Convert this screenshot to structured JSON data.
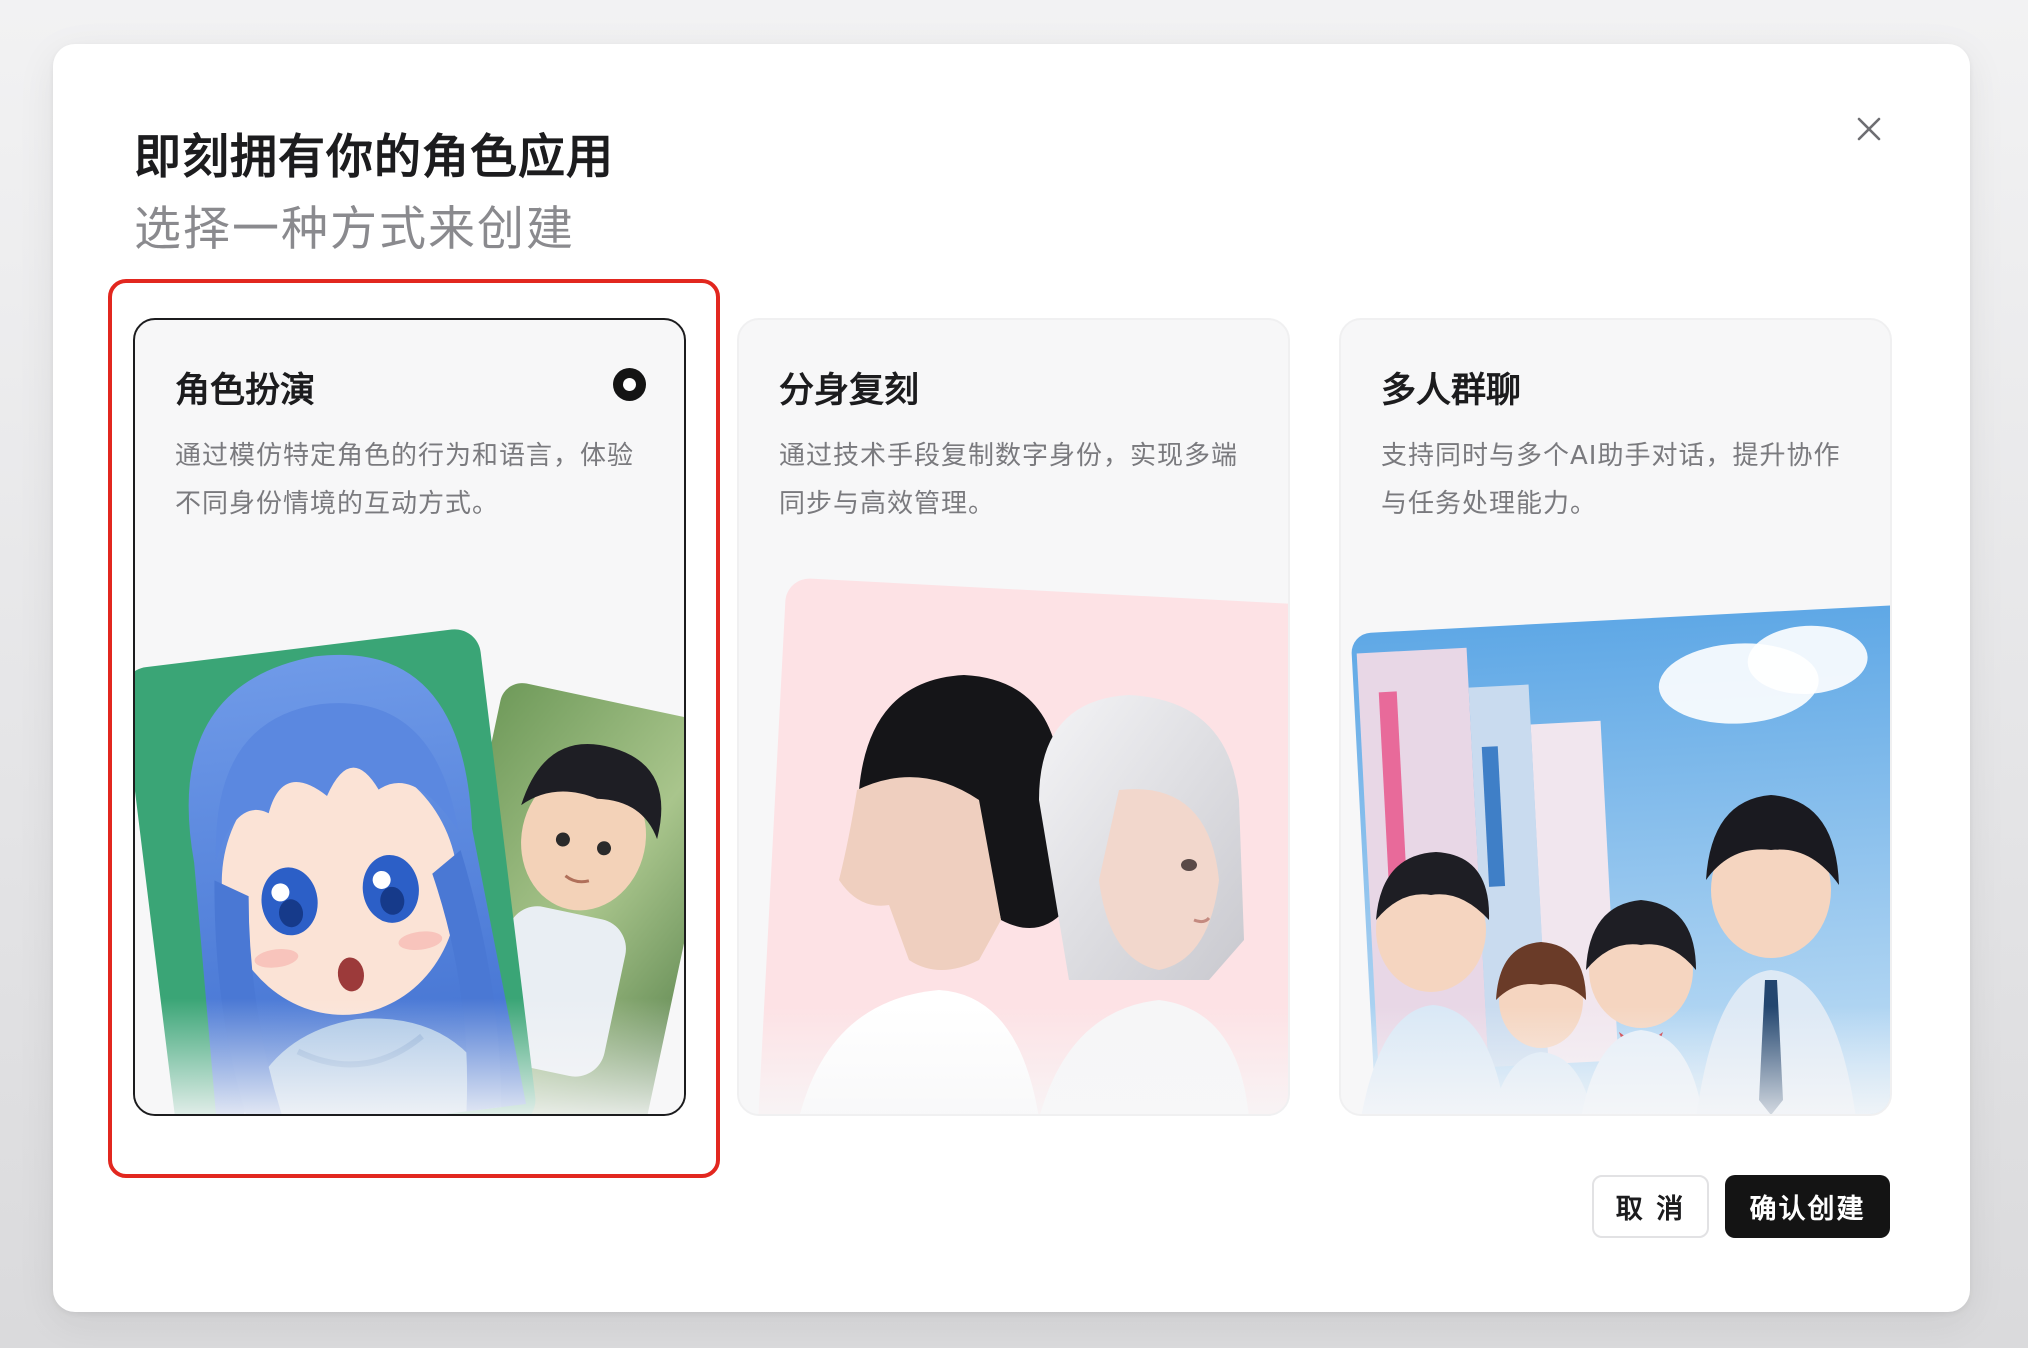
{
  "dialog": {
    "title": "即刻拥有你的角色应用",
    "subtitle": "选择一种方式来创建",
    "close_icon": "close-icon"
  },
  "options": [
    {
      "title": "角色扮演",
      "description": "通过模仿特定角色的行为和语言，体验不同身份情境的互动方式。",
      "selected": true,
      "image": "anime-girl-blue-hair-and-boy-cards"
    },
    {
      "title": "分身复刻",
      "description": "通过技术手段复制数字身份，实现多端同步与高效管理。",
      "selected": false,
      "image": "two-women-back-to-back-pink"
    },
    {
      "title": "多人群聊",
      "description": "支持同时与多个AI助手对话，提升协作与任务处理能力。",
      "selected": false,
      "image": "anime-students-city-street"
    }
  ],
  "actions": {
    "cancel_label": "取 消",
    "confirm_label": "确认创建"
  },
  "colors": {
    "accent": "#141414",
    "highlight_border": "#e2271f",
    "card_bg": "#f7f7f8"
  }
}
